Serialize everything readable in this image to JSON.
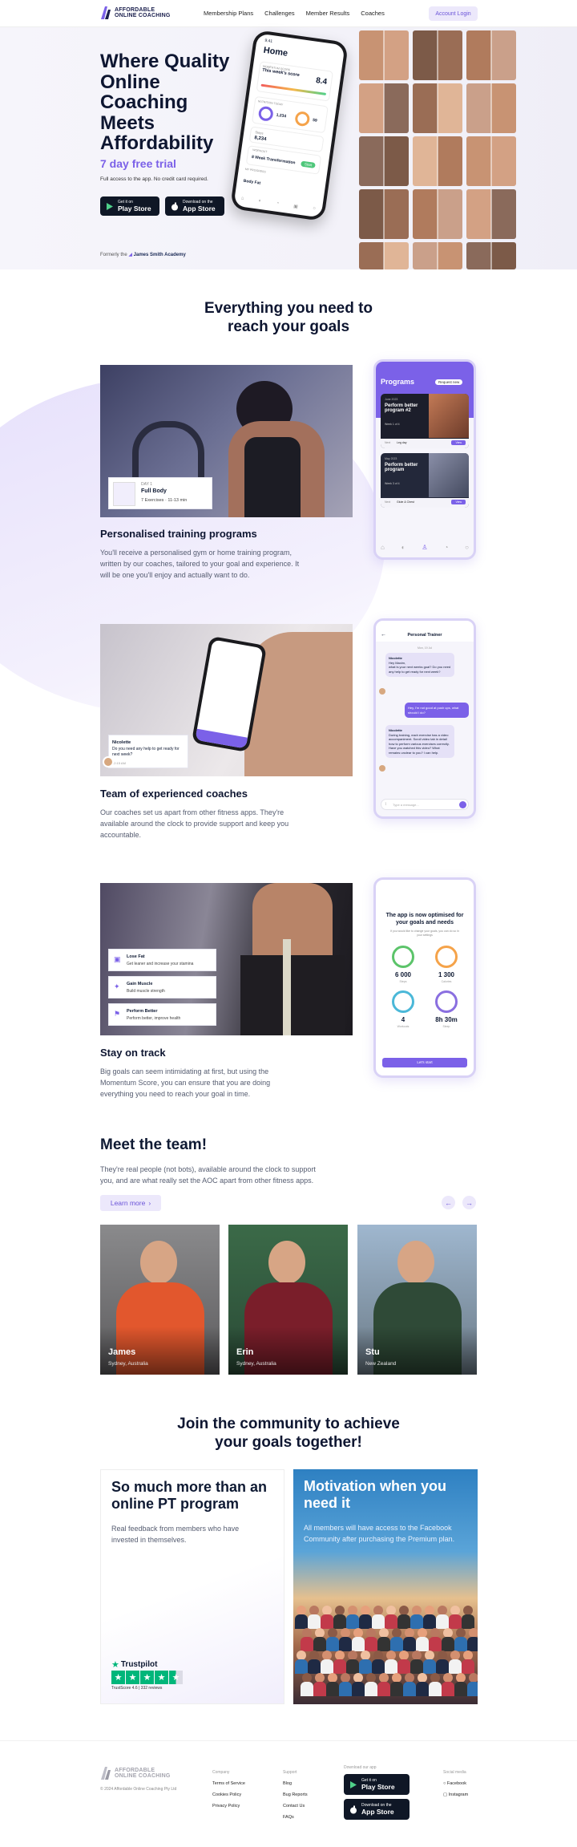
{
  "nav": {
    "brand_line1": "AFFORDABLE",
    "brand_line2": "ONLINE COACHING",
    "links": [
      "Membership Plans",
      "Challenges",
      "Member Results",
      "Coaches"
    ],
    "login": "Account Login"
  },
  "hero": {
    "title": "Where Quality Online Coaching Meets Affordability",
    "trial": "7 day free trial",
    "sub": "Full access to the app. No credit card required.",
    "play_small": "Get it on",
    "play_big": "Play Store",
    "app_small": "Download on the",
    "app_big": "App Store",
    "formerly_prefix": "Formerly the",
    "formerly_name": "James Smith Academy",
    "phone": {
      "time": "9:41",
      "home": "Home",
      "score_label": "MOMENTUM SCORE",
      "score_sub": "This week's score",
      "score_val": "8.4",
      "nutrition": "NUTRITION TODAY",
      "cal_val": "1,234",
      "prot_val": "59",
      "steps_label": "Steps",
      "steps_val": "8,234",
      "workout": "WORKOUT",
      "workout_name": "8 Week Transformation",
      "start": "Start",
      "progress": "MY PROGRESS",
      "body_fat": "Body Fat"
    }
  },
  "everything": {
    "title_l1": "Everything you need to",
    "title_l2": "reach your goals"
  },
  "features": [
    {
      "title": "Personalised training programs",
      "body": "You'll receive a personalised gym or home training program, written by our coaches, tailored to your goal and experience. It will be one you'll enjoy and actually want to do.",
      "card_day": "DAY 1",
      "card_title": "Full Body",
      "card_meta": "7 Exercises  ·  11-13 min"
    },
    {
      "title": "Team of experienced coaches",
      "body": "Our coaches set us apart from other fitness apps. They're available around the clock to provide support and keep you accountable.",
      "card_name": "Nicolette",
      "card_msg": "Do you need any help to get ready for next week?",
      "card_time": "12:15 AM"
    },
    {
      "title": "Stay on track",
      "body": "Big goals can seem intimidating at first, but using the Momentum Score, you can ensure that you are doing everything you need to reach your goal in time.",
      "opts": [
        {
          "t": "Lose Fat",
          "s": "Get leaner and increase your stamina"
        },
        {
          "t": "Gain Muscle",
          "s": "Build muscle strength"
        },
        {
          "t": "Perform Better",
          "s": "Perform better, improve health"
        }
      ]
    }
  ],
  "mock1": {
    "title": "Programs",
    "req": "Request new",
    "p1_date": "June 2023",
    "p1_name": "Perform better program #2",
    "p1_week": "Week 1 of 4",
    "p1_next": "Next",
    "p1_next_v": "Leg day",
    "p1_view": "View",
    "p2_date": "May 2023",
    "p2_name": "Perform better program",
    "p2_week": "Week 3 of 4",
    "p2_next": "Next",
    "p2_next_v": "Glute & Chest",
    "p2_view": "View"
  },
  "mock2": {
    "title": "Personal Trainer",
    "date": "Mon, 19 Jul",
    "m1_name": "Nicolette",
    "m1_a": "Hey Maxim,",
    "m1_b": "what is your next weeks goal? Do you need any help to get ready for next week?",
    "m2": "Hey, I'm not good at push ups, what should I do?",
    "m3_name": "Nicolette",
    "m3": "During training, each exercise has a video accompaniment. Scroll video tab in detail how to perform various exercises correctly. Have you watched this video? What remains unclear to you? I can help.",
    "input": "Type a message..."
  },
  "mock3": {
    "title": "The app is now optimised for your goals and needs",
    "sub": "If you would like to change your goals, you can do so in your settings",
    "v1": "6 000",
    "l1": "Steps",
    "v2": "1 300",
    "l2": "Calories",
    "v3": "4",
    "l3": "Workouts",
    "v4": "8h 30m",
    "l4": "Sleep",
    "btn": "Let's start"
  },
  "team": {
    "title": "Meet the team!",
    "body": "They're real people (not bots), available around the clock to support you, and are what really set the AOC apart from other fitness apps.",
    "learn": "Learn more",
    "members": [
      {
        "name": "James",
        "loc": "Sydney, Australia"
      },
      {
        "name": "Erin",
        "loc": "Sydney, Australia"
      },
      {
        "name": "Stu",
        "loc": "New Zealand"
      }
    ]
  },
  "community": {
    "title_l1": "Join the community to achieve",
    "title_l2": "your goals together!",
    "left_title": "So much more than an online PT program",
    "left_body": "Real feedback from members who have invested in themselves.",
    "tp": "Trustpilot",
    "tp_score": "TrustScore 4.6  |  332 reviews",
    "right_title": "Motivation when you need it",
    "right_body": "All members will have access to the Facebook Community after purchasing the Premium plan."
  },
  "footer": {
    "brand_line1": "AFFORDABLE",
    "brand_line2": "ONLINE COACHING",
    "copyright": "© 2024 Affordable Online Coaching Pty Ltd",
    "company_h": "Company",
    "company": [
      "Terms of Service",
      "Cookies Policy",
      "Privacy Policy"
    ],
    "support_h": "Support",
    "support": [
      "Blog",
      "Bug Reports",
      "Contact Us",
      "FAQs"
    ],
    "download_h": "Download our app",
    "social_h": "Social media",
    "social": [
      "Facebook",
      "Instagram"
    ],
    "play_small": "Get it on",
    "play_big": "Play Store",
    "app_small": "Download on the",
    "app_big": "App Store"
  },
  "colors": {
    "accent": "#7b61e8",
    "dark": "#0e1631"
  }
}
